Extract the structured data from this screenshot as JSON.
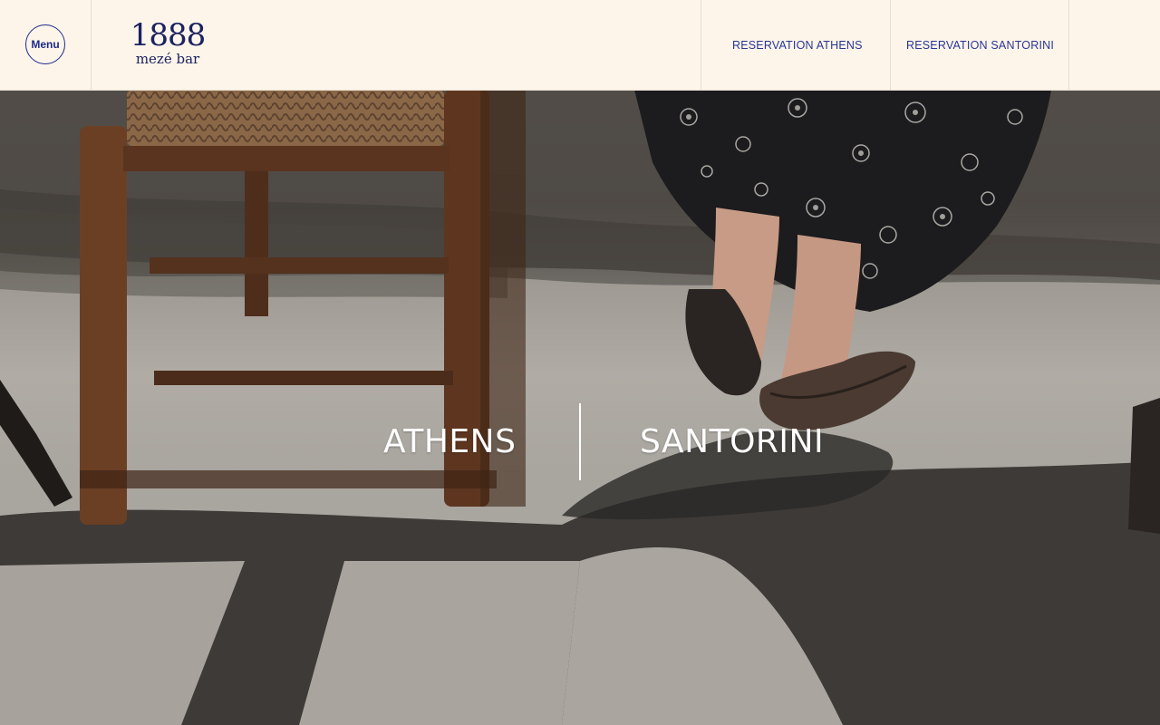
{
  "header": {
    "menu_label": "Menu",
    "logo_number": "1888",
    "logo_subtitle": "mezé bar",
    "nav": [
      {
        "label": "RESERVATION ATHENS"
      },
      {
        "label": "RESERVATION SANTORINI"
      }
    ]
  },
  "hero": {
    "cities": [
      {
        "label": "ATHENS"
      },
      {
        "label": "SANTORINI"
      }
    ]
  },
  "colors": {
    "header_bg": "#fdf5ea",
    "accent": "#1e2a8a",
    "logo": "#1b2260",
    "hero_text": "#ffffff"
  }
}
